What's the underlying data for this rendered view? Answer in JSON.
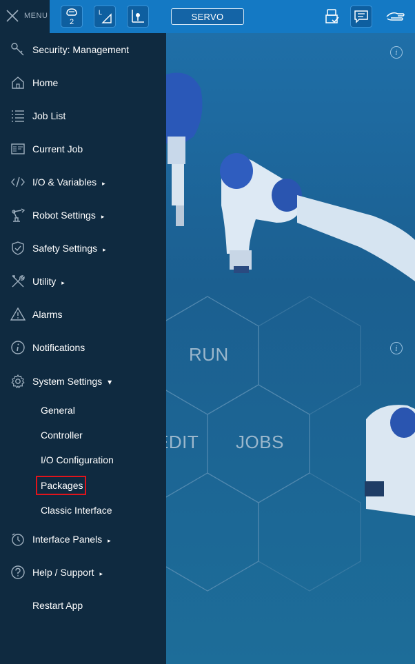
{
  "topbar": {
    "menu_label": "MENU",
    "robot_badge": "2",
    "servo_label": "SERVO"
  },
  "sidebar": {
    "items": [
      {
        "label": "Security: Management",
        "icon": "key-icon"
      },
      {
        "label": "Home",
        "icon": "home-icon"
      },
      {
        "label": "Job List",
        "icon": "list-icon"
      },
      {
        "label": "Current Job",
        "icon": "current-job-icon"
      },
      {
        "label": "I/O & Variables",
        "icon": "code-icon",
        "arrow": "▸"
      },
      {
        "label": "Robot Settings",
        "icon": "robot-arm-icon",
        "arrow": "▸"
      },
      {
        "label": "Safety Settings",
        "icon": "shield-icon",
        "arrow": "▸"
      },
      {
        "label": "Utility",
        "icon": "tools-icon",
        "arrow": "▸"
      },
      {
        "label": "Alarms",
        "icon": "warning-icon"
      },
      {
        "label": "Notifications",
        "icon": "info-icon"
      },
      {
        "label": "System Settings",
        "icon": "gear-icon",
        "arrow": "▾"
      },
      {
        "label": "Interface Panels",
        "icon": "stopwatch-icon",
        "arrow": "▸"
      },
      {
        "label": "Help / Support",
        "icon": "help-icon",
        "arrow": "▸"
      },
      {
        "label": "Restart App",
        "icon": ""
      }
    ],
    "system_settings_sub": [
      {
        "label": "General"
      },
      {
        "label": "Controller"
      },
      {
        "label": "I/O Configuration"
      },
      {
        "label": "Packages"
      },
      {
        "label": "Classic Interface"
      }
    ]
  },
  "background": {
    "tiles": [
      {
        "label": "RUN"
      },
      {
        "label": "EDIT"
      },
      {
        "label": "JOBS"
      }
    ]
  },
  "colors": {
    "topbar": "#1479c4",
    "sidebar": "#0f2a40",
    "highlight": "#e1141b"
  }
}
